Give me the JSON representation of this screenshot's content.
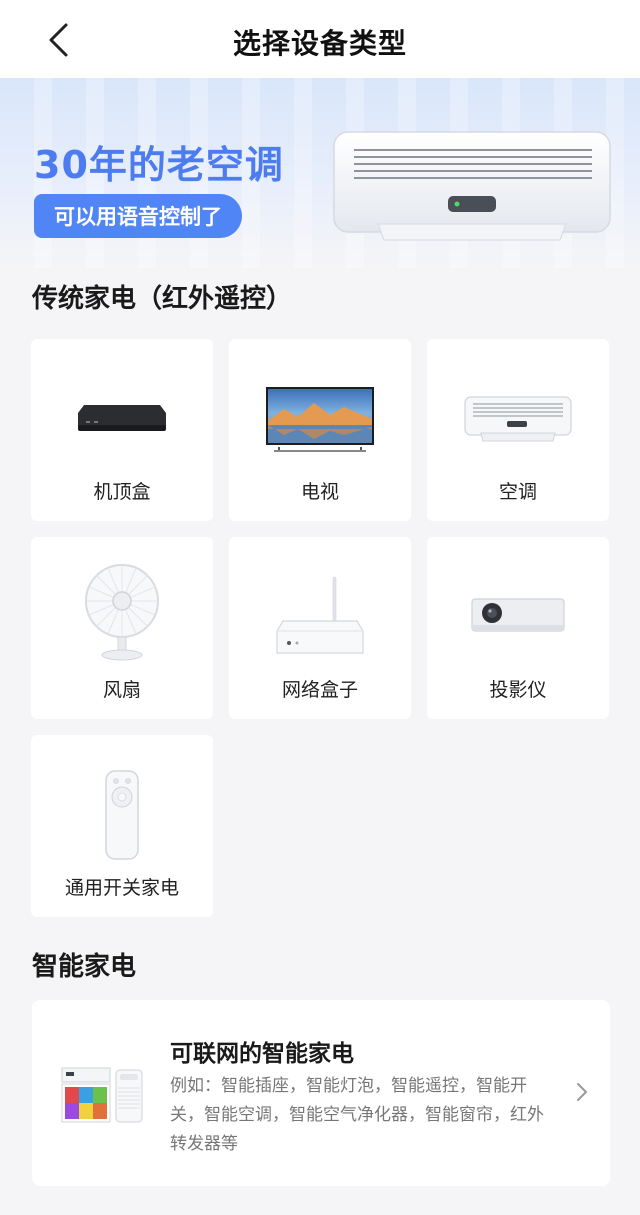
{
  "header": {
    "title": "选择设备类型",
    "back_icon": "chevron-left-icon"
  },
  "banner": {
    "title": "30年的老空调",
    "pill_text": "可以用语音控制了",
    "accent_color": "#4c7cf0",
    "image": "air-conditioner-illustration"
  },
  "traditional": {
    "section_title": "传统家电（红外遥控）",
    "devices": [
      {
        "label": "机顶盒",
        "icon": "set-top-box-icon"
      },
      {
        "label": "电视",
        "icon": "tv-icon"
      },
      {
        "label": "空调",
        "icon": "air-conditioner-icon"
      },
      {
        "label": "风扇",
        "icon": "fan-icon"
      },
      {
        "label": "网络盒子",
        "icon": "network-box-icon"
      },
      {
        "label": "投影仪",
        "icon": "projector-icon"
      },
      {
        "label": "通用开关家电",
        "icon": "remote-control-icon"
      }
    ]
  },
  "smart": {
    "section_title": "智能家电",
    "card_title": "可联网的智能家电",
    "card_desc": "例如：智能插座，智能灯泡，智能遥控，智能开关，智能空调，智能空气净化器，智能窗帘，红外转发器等",
    "chevron_icon": "chevron-right-icon"
  }
}
